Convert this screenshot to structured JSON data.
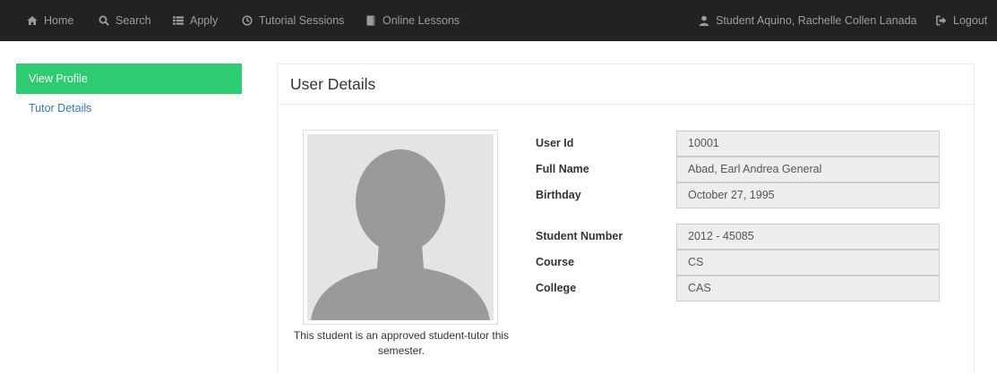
{
  "nav": {
    "home": "Home",
    "search": "Search",
    "apply": "Apply",
    "tutorial_sessions": "Tutorial Sessions",
    "online_lessons": "Online Lessons",
    "user": "Student Aquino, Rachelle Collen Lanada",
    "logout": "Logout"
  },
  "sidebar": {
    "items": [
      {
        "label": "View Profile",
        "active": true
      },
      {
        "label": "Tutor Details",
        "active": false
      }
    ]
  },
  "panel": {
    "title": "User Details",
    "photo_caption": "This student is an approved student-tutor this semester."
  },
  "details": {
    "user_id": {
      "label": "User Id",
      "value": "10001"
    },
    "full_name": {
      "label": "Full Name",
      "value": "Abad, Earl Andrea General"
    },
    "birthday": {
      "label": "Birthday",
      "value": "October 27, 1995"
    },
    "student_number": {
      "label": "Student Number",
      "value": "2012 - 45085"
    },
    "course": {
      "label": "Course",
      "value": "CS"
    },
    "college": {
      "label": "College",
      "value": "CAS"
    }
  },
  "colors": {
    "navbar_bg": "#222222",
    "nav_text": "#9d9d9d",
    "active_green": "#2ecc71",
    "link_blue": "#337ab7",
    "field_bg": "#eeeeee"
  }
}
